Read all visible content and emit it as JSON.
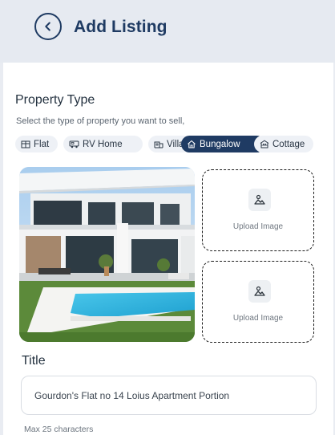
{
  "header": {
    "title": "Add Listing",
    "back_icon": "chevron-left-icon"
  },
  "property_type": {
    "heading": "Property Type",
    "subtitle": "Select the type of property you want to sell,",
    "selected": "Bungalow",
    "options": [
      {
        "label": "Flat",
        "icon": "flat-icon"
      },
      {
        "label": "RV Home",
        "icon": "rv-icon"
      },
      {
        "label": "Villa",
        "icon": "villa-icon"
      },
      {
        "label": "Bungalow",
        "icon": "house-icon"
      },
      {
        "label": "Cottage",
        "icon": "cottage-icon"
      }
    ]
  },
  "images": {
    "upload_slots": [
      {
        "label": "Upload Image",
        "icon": "image-icon"
      },
      {
        "label": "Upload Image",
        "icon": "image-icon"
      }
    ]
  },
  "title_field": {
    "label": "Title",
    "value": "Gourdon's Flat no 14 Loius Apartment Portion",
    "hint": "Max 25 characters"
  },
  "colors": {
    "accent": "#1f3b63",
    "header_bg": "#e6eaf1",
    "chip_bg": "#eef1f6"
  }
}
